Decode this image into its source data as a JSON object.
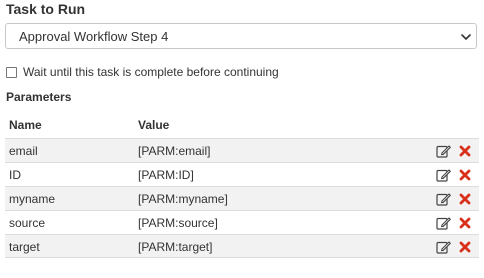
{
  "task": {
    "title": "Task to Run",
    "selected": "Approval Workflow Step 4"
  },
  "wait_option": {
    "label": "Wait until this task is complete before continuing",
    "checked": false
  },
  "parameters": {
    "title": "Parameters",
    "columns": {
      "name": "Name",
      "value": "Value"
    },
    "rows": [
      {
        "name": "email",
        "value": "[PARM:email]"
      },
      {
        "name": "ID",
        "value": "[PARM:ID]"
      },
      {
        "name": "myname",
        "value": "[PARM:myname]"
      },
      {
        "name": "source",
        "value": "[PARM:source]"
      },
      {
        "name": "target",
        "value": "[PARM:target]"
      }
    ]
  },
  "icons": {
    "edit": "edit-icon",
    "delete": "delete-icon",
    "dropdown": "chevron-down-icon"
  },
  "colors": {
    "delete": "#d9301c",
    "row_alt": "#f2f2f2",
    "border": "#c8c8c8"
  }
}
